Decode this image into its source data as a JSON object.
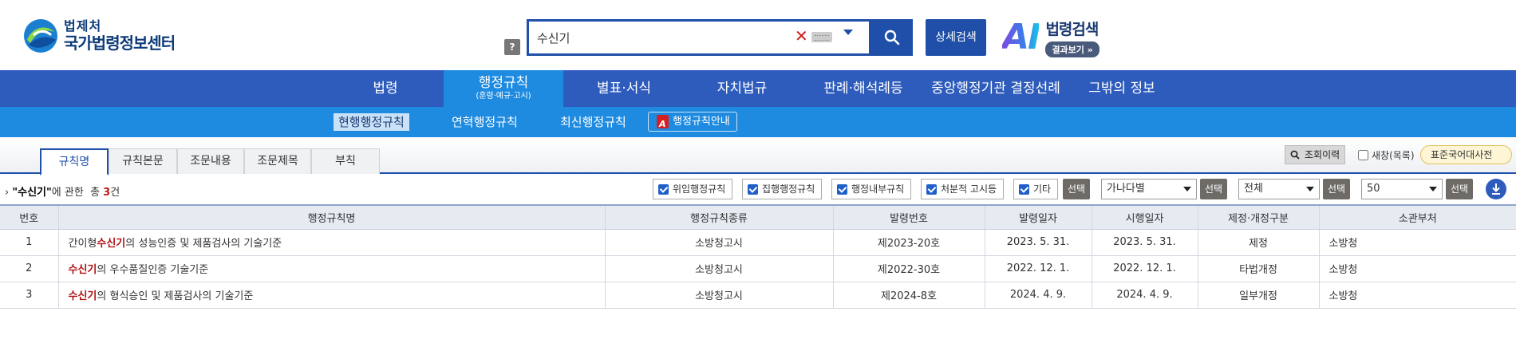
{
  "header": {
    "logo_sub": "법제처",
    "logo_main": "국가법령정보센터",
    "help_label": "?",
    "search_value": "수신기",
    "search_clear": "✕",
    "detail_search": "상세검색",
    "ai_letters": "AI",
    "ai_title": "법령검색",
    "ai_sub": "결과보기 »"
  },
  "mainnav": [
    {
      "label": "법령"
    },
    {
      "label": "행정규칙",
      "sub": "(훈령·예규·고시)"
    },
    {
      "label": "별표·서식"
    },
    {
      "label": "자치법규"
    },
    {
      "label": "판례·해석례등"
    },
    {
      "label": "중앙행정기관 결정선례"
    },
    {
      "label": "그밖의 정보"
    }
  ],
  "subnav": {
    "items": [
      "현행행정규칙",
      "연혁행정규칙",
      "최신행정규칙"
    ],
    "guide": "행정규칙안내"
  },
  "tabs": [
    "규칙명",
    "규칙본문",
    "조문내용",
    "조문제목",
    "부칙"
  ],
  "tools": {
    "history": "조회이력",
    "new_window": "새창(목록)",
    "dictionary": "표준국어대사전"
  },
  "filter": {
    "query": "\"수신기\"",
    "about": "에 관한",
    "total_label": "총",
    "count": "3",
    "count_unit": "건",
    "checks": [
      "위임행정규칙",
      "집행행정규칙",
      "행정내부규칙",
      "처분적 고시등",
      "기타"
    ],
    "select_label": "선택",
    "sort_value": "가나다별",
    "scope_value": "전체",
    "page_size": "50"
  },
  "table": {
    "headers": [
      "번호",
      "행정규칙명",
      "행정규칙종류",
      "발령번호",
      "발령일자",
      "시행일자",
      "제정·개정구분",
      "소관부처"
    ],
    "rows": [
      {
        "no": "1",
        "pre": "간이형",
        "kw": "수신기",
        "post": "의 성능인증 및 제품검사의 기술기준",
        "kind": "소방청고시",
        "num": "제2023-20호",
        "issued": "2023. 5. 31.",
        "effective": "2023. 5. 31.",
        "type": "제정",
        "dept": "소방청"
      },
      {
        "no": "2",
        "pre": "",
        "kw": "수신기",
        "post": "의 우수품질인증 기술기준",
        "kind": "소방청고시",
        "num": "제2022-30호",
        "issued": "2022. 12. 1.",
        "effective": "2022. 12. 1.",
        "type": "타법개정",
        "dept": "소방청"
      },
      {
        "no": "3",
        "pre": "",
        "kw": "수신기",
        "post": "의 형식승인 및 제품검사의 기술기준",
        "kind": "소방청고시",
        "num": "제2024-8호",
        "issued": "2024. 4. 9.",
        "effective": "2024. 4. 9.",
        "type": "일부개정",
        "dept": "소방청"
      }
    ]
  },
  "colors": {
    "primary": "#1f4fa8",
    "nav": "#2e5cbc",
    "subnav": "#1e8be0",
    "highlight": "#b01010"
  }
}
